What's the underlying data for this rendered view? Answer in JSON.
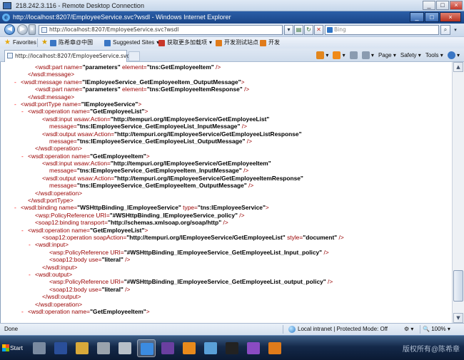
{
  "remote_window": {
    "title": "218.242.3.116 - Remote Desktop Connection",
    "buttons": [
      "_",
      "□",
      "×"
    ]
  },
  "browser": {
    "title": "http://localhost:8207/EmployeeService.svc?wsdl - Windows Internet Explorer",
    "window_buttons": [
      "_",
      "□",
      "×"
    ],
    "address": "http://localhost:8207/EmployeeService.svc?wsdl",
    "search_placeholder": "Bing",
    "favorites": [
      {
        "label": "Favorites",
        "icon": "star-icon"
      },
      {
        "label": "陈希章@中国",
        "icon": "link-icon"
      },
      {
        "label": "Suggested Sites",
        "icon": "suggested-sites-icon"
      },
      {
        "label": "获取更多加载项",
        "icon": "add-ons-icon"
      },
      {
        "label": "开发测试站点",
        "icon": "folder-icon"
      },
      {
        "label": "开发",
        "icon": "folder-icon"
      }
    ],
    "tab_title": "http://localhost:8207/EmployeeService.svc?wsdl",
    "commands": [
      "Page",
      "Safety",
      "Tools"
    ]
  },
  "xml_lines": [
    {
      "indent": 3,
      "minus": false,
      "parts": [
        [
          "t",
          "<wsdl:part "
        ],
        [
          "a",
          "name="
        ],
        [
          "v",
          "\"parameters\""
        ],
        [
          "a",
          " element="
        ],
        [
          "v",
          "\"tns:GetEmployeeItem\""
        ],
        [
          "t",
          " />"
        ]
      ]
    },
    {
      "indent": 2,
      "minus": false,
      "parts": [
        [
          "t",
          "</wsdl:message>"
        ]
      ]
    },
    {
      "indent": 1,
      "minus": true,
      "parts": [
        [
          "t",
          "<wsdl:message "
        ],
        [
          "a",
          "name="
        ],
        [
          "v",
          "\"IEmployeeService_GetEmployeeItem_OutputMessage\""
        ],
        [
          "t",
          ">"
        ]
      ]
    },
    {
      "indent": 3,
      "minus": false,
      "parts": [
        [
          "t",
          "<wsdl:part "
        ],
        [
          "a",
          "name="
        ],
        [
          "v",
          "\"parameters\""
        ],
        [
          "a",
          " element="
        ],
        [
          "v",
          "\"tns:GetEmployeeItemResponse\""
        ],
        [
          "t",
          " />"
        ]
      ]
    },
    {
      "indent": 2,
      "minus": false,
      "parts": [
        [
          "t",
          "</wsdl:message>"
        ]
      ]
    },
    {
      "indent": 1,
      "minus": true,
      "parts": [
        [
          "t",
          "<wsdl:portType "
        ],
        [
          "a",
          "name="
        ],
        [
          "v",
          "\"IEmployeeService\""
        ],
        [
          "t",
          ">"
        ]
      ]
    },
    {
      "indent": 2,
      "minus": true,
      "parts": [
        [
          "t",
          "<wsdl:operation "
        ],
        [
          "a",
          "name="
        ],
        [
          "v",
          "\"GetEmployeeList\""
        ],
        [
          "t",
          ">"
        ]
      ]
    },
    {
      "indent": 4,
      "minus": false,
      "parts": [
        [
          "t",
          "<wsdl:input "
        ],
        [
          "a",
          "wsaw:Action="
        ],
        [
          "v",
          "\"http://tempuri.org/IEmployeeService/GetEmployeeList\""
        ]
      ]
    },
    {
      "indent": 5,
      "minus": false,
      "parts": [
        [
          "a",
          "message="
        ],
        [
          "v",
          "\"tns:IEmployeeService_GetEmployeeList_InputMessage\""
        ],
        [
          "t",
          " />"
        ]
      ]
    },
    {
      "indent": 4,
      "minus": false,
      "parts": [
        [
          "t",
          "<wsdl:output "
        ],
        [
          "a",
          "wsaw:Action="
        ],
        [
          "v",
          "\"http://tempuri.org/IEmployeeService/GetEmployeeListResponse\""
        ]
      ]
    },
    {
      "indent": 5,
      "minus": false,
      "parts": [
        [
          "a",
          "message="
        ],
        [
          "v",
          "\"tns:IEmployeeService_GetEmployeeList_OutputMessage\""
        ],
        [
          "t",
          " />"
        ]
      ]
    },
    {
      "indent": 3,
      "minus": false,
      "parts": [
        [
          "t",
          "</wsdl:operation>"
        ]
      ]
    },
    {
      "indent": 2,
      "minus": true,
      "parts": [
        [
          "t",
          "<wsdl:operation "
        ],
        [
          "a",
          "name="
        ],
        [
          "v",
          "\"GetEmployeeItem\""
        ],
        [
          "t",
          ">"
        ]
      ]
    },
    {
      "indent": 4,
      "minus": false,
      "parts": [
        [
          "t",
          "<wsdl:input "
        ],
        [
          "a",
          "wsaw:Action="
        ],
        [
          "v",
          "\"http://tempuri.org/IEmployeeService/GetEmployeeItem\""
        ]
      ]
    },
    {
      "indent": 5,
      "minus": false,
      "parts": [
        [
          "a",
          "message="
        ],
        [
          "v",
          "\"tns:IEmployeeService_GetEmployeeItem_InputMessage\""
        ],
        [
          "t",
          " />"
        ]
      ]
    },
    {
      "indent": 4,
      "minus": false,
      "parts": [
        [
          "t",
          "<wsdl:output "
        ],
        [
          "a",
          "wsaw:Action="
        ],
        [
          "v",
          "\"http://tempuri.org/IEmployeeService/GetEmployeeItemResponse\""
        ]
      ]
    },
    {
      "indent": 5,
      "minus": false,
      "parts": [
        [
          "a",
          "message="
        ],
        [
          "v",
          "\"tns:IEmployeeService_GetEmployeeItem_OutputMessage\""
        ],
        [
          "t",
          " />"
        ]
      ]
    },
    {
      "indent": 3,
      "minus": false,
      "parts": [
        [
          "t",
          "</wsdl:operation>"
        ]
      ]
    },
    {
      "indent": 2,
      "minus": false,
      "parts": [
        [
          "t",
          "</wsdl:portType>"
        ]
      ]
    },
    {
      "indent": 1,
      "minus": true,
      "parts": [
        [
          "t",
          "<wsdl:binding "
        ],
        [
          "a",
          "name="
        ],
        [
          "v",
          "\"WSHttpBinding_IEmployeeService\""
        ],
        [
          "a",
          " type="
        ],
        [
          "v",
          "\"tns:IEmployeeService\""
        ],
        [
          "t",
          ">"
        ]
      ]
    },
    {
      "indent": 3,
      "minus": false,
      "parts": [
        [
          "t",
          "<wsp:PolicyReference "
        ],
        [
          "a",
          "URI="
        ],
        [
          "v",
          "\"#WSHttpBinding_IEmployeeService_policy\""
        ],
        [
          "t",
          " />"
        ]
      ]
    },
    {
      "indent": 3,
      "minus": false,
      "parts": [
        [
          "t",
          "<soap12:binding "
        ],
        [
          "a",
          "transport="
        ],
        [
          "v",
          "\"http://schemas.xmlsoap.org/soap/http\""
        ],
        [
          "t",
          " />"
        ]
      ]
    },
    {
      "indent": 2,
      "minus": true,
      "parts": [
        [
          "t",
          "<wsdl:operation "
        ],
        [
          "a",
          "name="
        ],
        [
          "v",
          "\"GetEmployeeList\""
        ],
        [
          "t",
          ">"
        ]
      ]
    },
    {
      "indent": 4,
      "minus": false,
      "parts": [
        [
          "t",
          "<soap12:operation "
        ],
        [
          "a",
          "soapAction="
        ],
        [
          "v",
          "\"http://tempuri.org/IEmployeeService/GetEmployeeList\""
        ],
        [
          "a",
          " style="
        ],
        [
          "v",
          "\"document\""
        ],
        [
          "t",
          " />"
        ]
      ]
    },
    {
      "indent": 3,
      "minus": true,
      "parts": [
        [
          "t",
          "<wsdl:input>"
        ]
      ]
    },
    {
      "indent": 5,
      "minus": false,
      "parts": [
        [
          "t",
          "<wsp:PolicyReference "
        ],
        [
          "a",
          "URI="
        ],
        [
          "v",
          "\"#WSHttpBinding_IEmployeeService_GetEmployeeList_Input_policy\""
        ],
        [
          "t",
          " />"
        ]
      ]
    },
    {
      "indent": 5,
      "minus": false,
      "parts": [
        [
          "t",
          "<soap12:body "
        ],
        [
          "a",
          "use="
        ],
        [
          "v",
          "\"literal\""
        ],
        [
          "t",
          " />"
        ]
      ]
    },
    {
      "indent": 4,
      "minus": false,
      "parts": [
        [
          "t",
          "</wsdl:input>"
        ]
      ]
    },
    {
      "indent": 3,
      "minus": true,
      "parts": [
        [
          "t",
          "<wsdl:output>"
        ]
      ]
    },
    {
      "indent": 5,
      "minus": false,
      "parts": [
        [
          "t",
          "<wsp:PolicyReference "
        ],
        [
          "a",
          "URI="
        ],
        [
          "v",
          "\"#WSHttpBinding_IEmployeeService_GetEmployeeList_output_policy\""
        ],
        [
          "t",
          " />"
        ]
      ]
    },
    {
      "indent": 5,
      "minus": false,
      "parts": [
        [
          "t",
          "<soap12:body "
        ],
        [
          "a",
          "use="
        ],
        [
          "v",
          "\"literal\""
        ],
        [
          "t",
          " />"
        ]
      ]
    },
    {
      "indent": 4,
      "minus": false,
      "parts": [
        [
          "t",
          "</wsdl:output>"
        ]
      ]
    },
    {
      "indent": 3,
      "minus": false,
      "parts": [
        [
          "t",
          "</wsdl:operation>"
        ]
      ]
    },
    {
      "indent": 2,
      "minus": true,
      "parts": [
        [
          "t",
          "<wsdl:operation "
        ],
        [
          "a",
          "name="
        ],
        [
          "v",
          "\"GetEmployeeItem\""
        ],
        [
          "t",
          ">"
        ]
      ]
    }
  ],
  "status": {
    "left": "Done",
    "zone": "Local intranet | Protected Mode: Off",
    "zoom": "100%"
  },
  "taskbar": {
    "start_label": "Start",
    "icons": [
      {
        "name": "server-manager-icon",
        "color": "#7a8aa0"
      },
      {
        "name": "powershell-icon",
        "color": "#2a4f9a"
      },
      {
        "name": "explorer-icon",
        "color": "#d9a93a"
      },
      {
        "name": "tools-icon",
        "color": "#9aa3ad"
      },
      {
        "name": "settings-icon",
        "color": "#b8c0c8"
      },
      {
        "name": "ie-icon",
        "color": "#3b8be0",
        "active": true
      },
      {
        "name": "visual-studio-icon",
        "color": "#6a3fa0"
      },
      {
        "name": "tools-orange-icon",
        "color": "#e88a1c"
      },
      {
        "name": "paint-icon",
        "color": "#5aa0d8"
      },
      {
        "name": "console-icon",
        "color": "#222222"
      },
      {
        "name": "vs-orange-icon",
        "color": "#8a4bc2"
      },
      {
        "name": "slides-icon",
        "color": "#e07b1a"
      }
    ],
    "watermark": "版权所有@陈希章"
  }
}
